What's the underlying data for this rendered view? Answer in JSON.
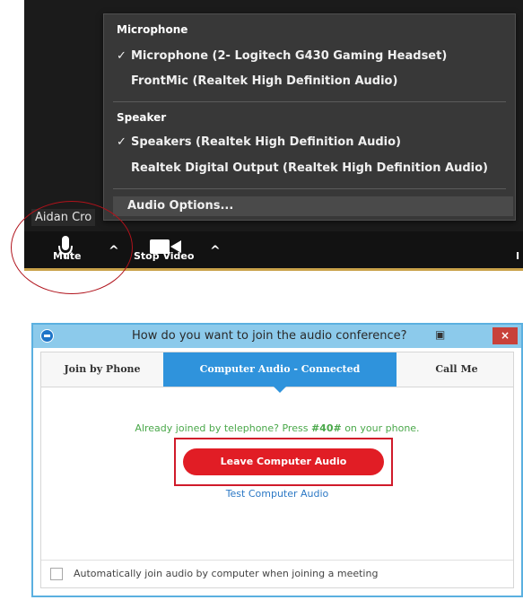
{
  "menu": {
    "microphone_header": "Microphone",
    "microphone_items": [
      {
        "label": "Microphone (2- Logitech G430 Gaming Headset)",
        "checked": true
      },
      {
        "label": "FrontMic (Realtek High Definition Audio)",
        "checked": false
      }
    ],
    "speaker_header": "Speaker",
    "speaker_items": [
      {
        "label": "Speakers (Realtek High Definition Audio)",
        "checked": true
      },
      {
        "label": "Realtek Digital Output (Realtek High Definition Audio)",
        "checked": false
      }
    ],
    "audio_options": "Audio Options...",
    "check_glyph": "✓"
  },
  "meeting": {
    "participant_name": "Aidan Cro",
    "mute_label": "Mute",
    "stop_video_label": "Stop Video",
    "caret_glyph": "^",
    "partial_label": "I"
  },
  "dialog": {
    "title": "How do you want to join the audio conference?",
    "close_glyph": "×",
    "pin_glyph": "▣",
    "tabs": [
      "Join by Phone",
      "Computer Audio - Connected",
      "Call Me"
    ],
    "already_prefix": "Already joined by telephone? Press ",
    "already_code": "#40#",
    "already_suffix": " on your phone.",
    "leave_button": "Leave Computer Audio",
    "test_link": "Test Computer Audio",
    "auto_join_label": "Automatically join audio by computer when joining a meeting"
  },
  "colors": {
    "menu_bg": "#383838",
    "dialog_border": "#5bb0e0",
    "active_tab": "#2f93dc",
    "leave_button": "#e11d25",
    "highlight_ring": "#b0121b"
  },
  "icons": [
    "microphone-icon",
    "video-camera-icon",
    "caret-up-icon",
    "app-icon",
    "close-icon",
    "pin-icon",
    "check-icon"
  ]
}
